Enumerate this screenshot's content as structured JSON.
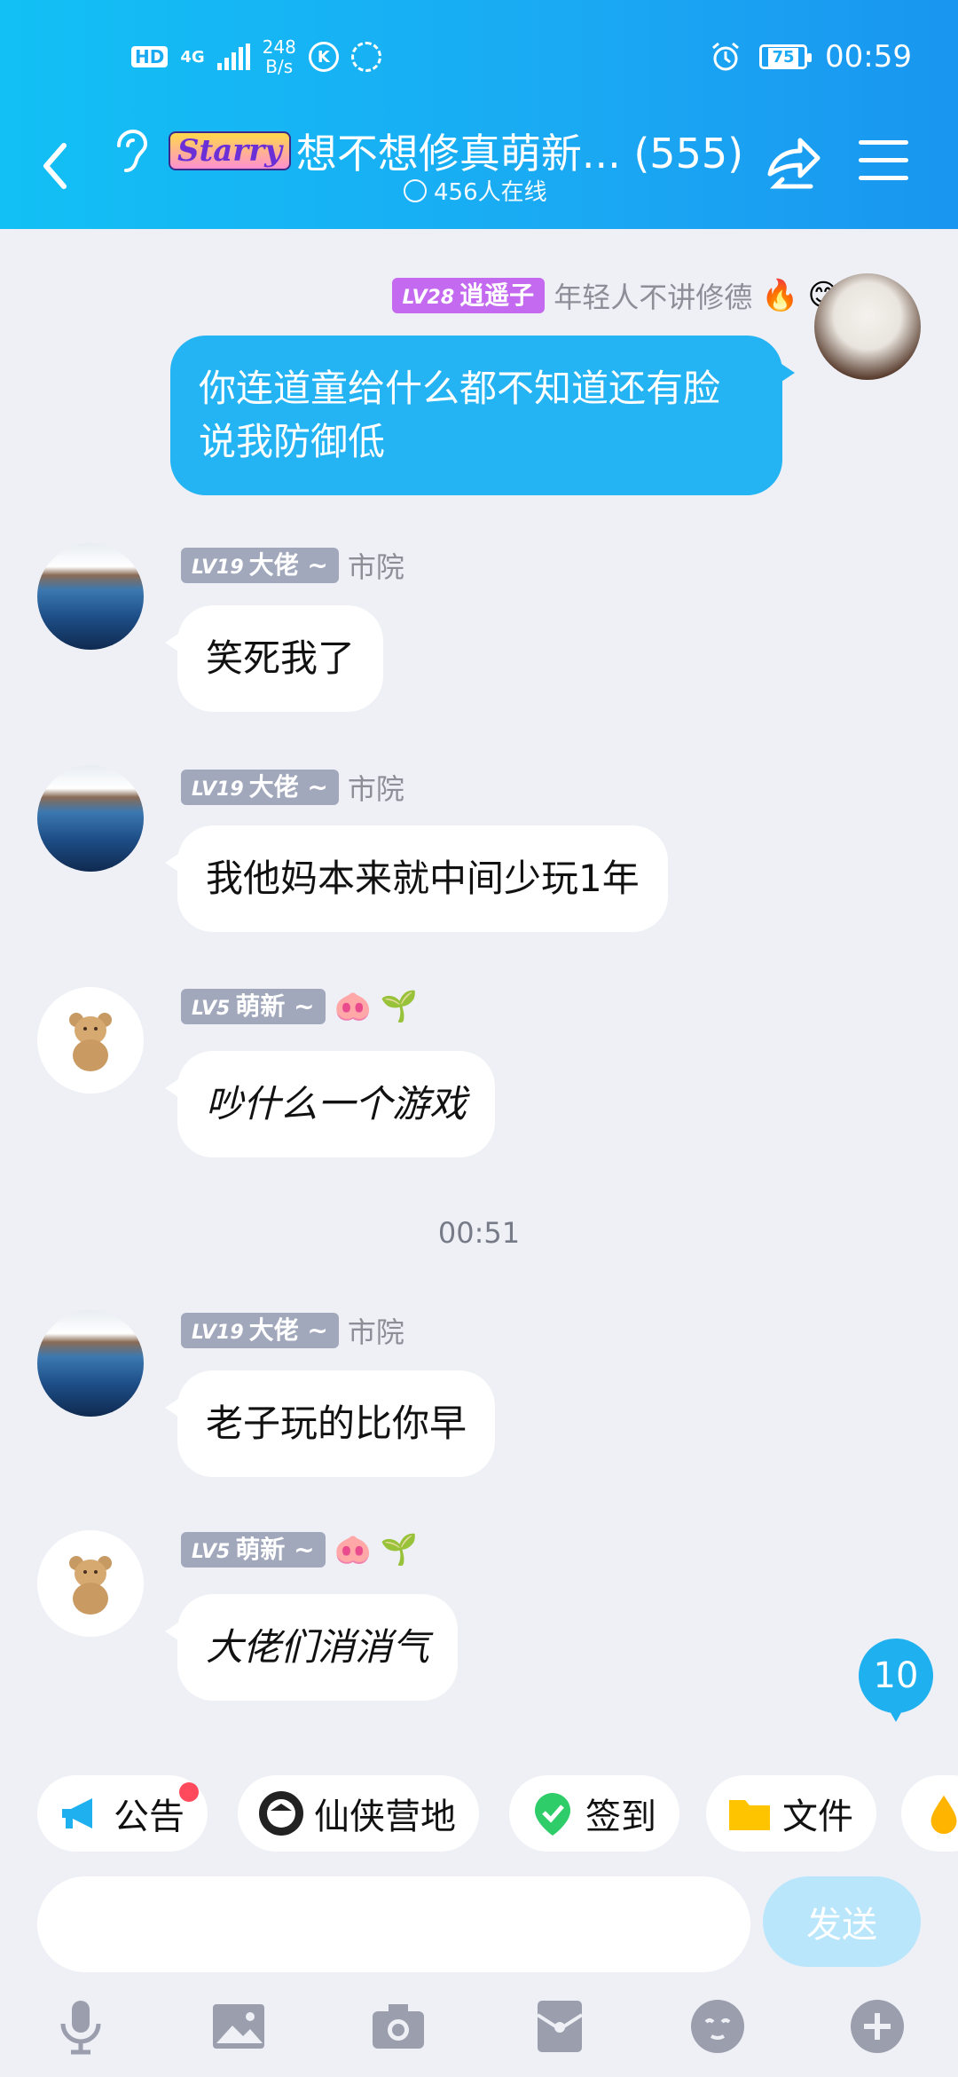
{
  "status_bar": {
    "hd": "HD",
    "network": "4G",
    "speed_value": "248",
    "speed_unit": "B/s",
    "icon_k": "K",
    "battery": "75",
    "time": "00:59"
  },
  "header": {
    "group_badge": "Starry",
    "title": "想不想修真萌新... (555)",
    "online": "456人在线"
  },
  "messages": [
    {
      "level": "LV28",
      "name": "逍遥子",
      "remark": "年轻人不讲修德",
      "text": "你连道童给什么都不知道还有脸说我防御低",
      "emojis": [
        "🔥",
        "😊"
      ]
    },
    {
      "level": "LV19",
      "name": "大佬 ~",
      "remark": "市院",
      "text": "笑死我了"
    },
    {
      "level": "LV19",
      "name": "大佬 ~",
      "remark": "市院",
      "text": "我他妈本来就中间少玩1年"
    },
    {
      "level": "LV5",
      "name": "萌新 ~",
      "remark": "",
      "text": "吵什么一个游戏",
      "emojis": [
        "🐽",
        "🌱"
      ]
    },
    {
      "level": "LV19",
      "name": "大佬 ~",
      "remark": "市院",
      "text": "老子玩的比你早"
    },
    {
      "level": "LV5",
      "name": "萌新 ~",
      "remark": "",
      "text": "大佬们消消气",
      "emojis": [
        "🐽",
        "🌱"
      ]
    }
  ],
  "timestamp": "00:51",
  "unread_count": "10",
  "toolbar_chips": [
    "公告",
    "仙侠营地",
    "签到",
    "文件"
  ],
  "input": {
    "placeholder": "",
    "send_label": "发送"
  },
  "colors": {
    "header": "#1aa9f3",
    "bubble_me": "#24b3f3",
    "background": "#eef0f6"
  }
}
